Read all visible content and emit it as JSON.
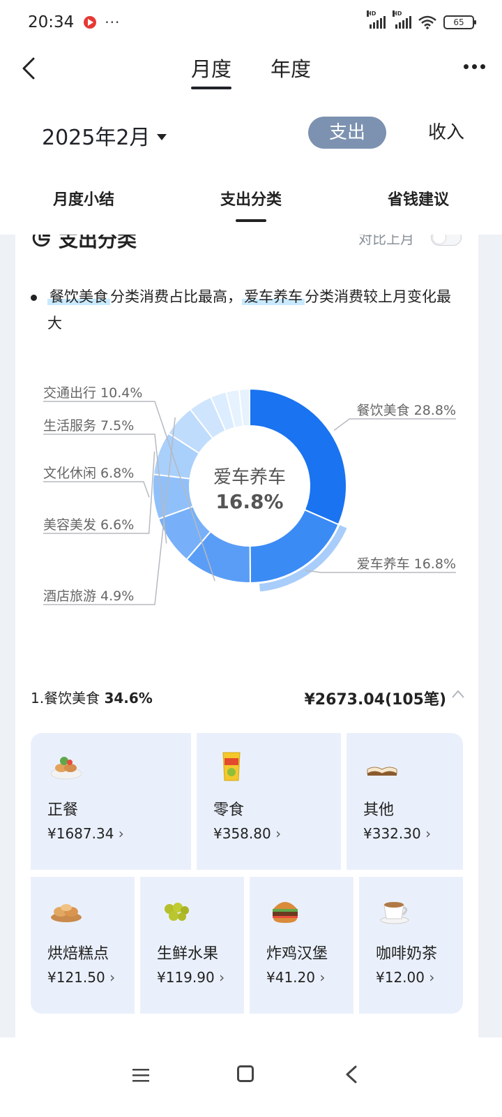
{
  "status_bar": {
    "time": "20:34",
    "dots": "···",
    "battery": "65",
    "network": "HD"
  },
  "header": {
    "tabs": [
      {
        "label": "月度"
      },
      {
        "label": "年度"
      }
    ],
    "month": "2025年2月",
    "type_toggle": {
      "expense": "支出",
      "income": "收入"
    },
    "sub_tabs": [
      {
        "label": "月度小结"
      },
      {
        "label": "支出分类"
      },
      {
        "label": "省钱建议"
      }
    ]
  },
  "card": {
    "title": "支出分类",
    "compare_label": "对比上月",
    "insight": {
      "highlight1": "餐饮美食",
      "text1": "分类消费占比最高，",
      "highlight2": "爱车养车",
      "text2": "分类消费较上月变化最大"
    }
  },
  "colors": {
    "slice": [
      "#1a73f0",
      "#3b8bf5",
      "#5a9df6",
      "#77b0f8",
      "#90c0fa",
      "#a9cffb",
      "#c0dcfc",
      "#cfe5fd",
      "#dbedfe",
      "#e6f2fe"
    ],
    "accent_highlight": "#c9eafe",
    "toggle_active": "#7c92b0"
  },
  "chart_data": {
    "type": "pie",
    "style": "donut",
    "center_label": "爱车养车",
    "center_value": "16.8%",
    "highlighted": "爱车养车",
    "slices": [
      {
        "label": "餐饮美食",
        "value": 28.8
      },
      {
        "label": "爱车养车",
        "value": 16.8
      },
      {
        "label": "交通出行",
        "value": 10.4
      },
      {
        "label": "生活服务",
        "value": 7.5
      },
      {
        "label": "文化休闲",
        "value": 6.8
      },
      {
        "label": "美容美发",
        "value": 6.6
      },
      {
        "label": "酒店旅游",
        "value": 4.9
      },
      {
        "label": "",
        "value": 3.6
      },
      {
        "label": "",
        "value": 2.4
      },
      {
        "label": "",
        "value": 2.0
      },
      {
        "label": "",
        "value": 1.6
      }
    ],
    "labels": [
      {
        "text": "餐饮美食 28.8%",
        "side": "right"
      },
      {
        "text": "爱车养车 16.8%",
        "side": "right"
      },
      {
        "text": "交通出行 10.4%",
        "side": "left"
      },
      {
        "text": "生活服务 7.5%",
        "side": "left"
      },
      {
        "text": "文化休闲 6.8%",
        "side": "left"
      },
      {
        "text": "美容美发 6.6%",
        "side": "left"
      },
      {
        "text": "酒店旅游 4.9%",
        "side": "left"
      }
    ]
  },
  "category": {
    "index_name": "1.餐饮美食",
    "share": "34.6%",
    "amount": "¥2673.04(105笔)",
    "items": [
      {
        "name": "正餐",
        "value": "¥1687.34",
        "icon": "meal-icon"
      },
      {
        "name": "零食",
        "value": "¥358.80",
        "icon": "snack-icon"
      },
      {
        "name": "其他",
        "value": "¥332.30",
        "icon": "book-icon"
      },
      {
        "name": "烘焙糕点",
        "value": "¥121.50",
        "icon": "bread-icon"
      },
      {
        "name": "生鲜水果",
        "value": "¥119.90",
        "icon": "grapes-icon"
      },
      {
        "name": "炸鸡汉堡",
        "value": "¥41.20",
        "icon": "burger-icon"
      },
      {
        "name": "咖啡奶茶",
        "value": "¥12.00",
        "icon": "coffee-icon"
      }
    ]
  }
}
